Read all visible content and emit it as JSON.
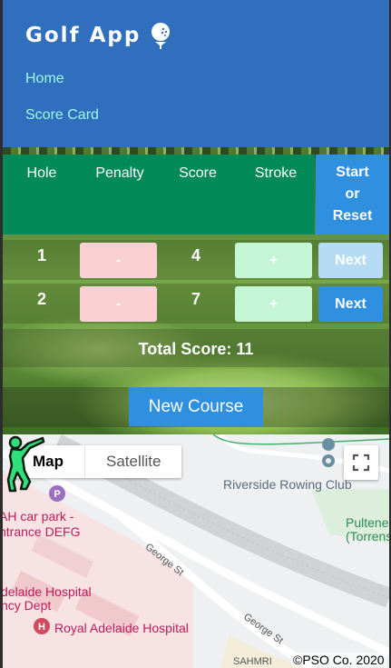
{
  "header": {
    "brand": "Golf App",
    "nav": [
      {
        "label": "Home"
      },
      {
        "label": "Score Card"
      }
    ],
    "logo_icon": "golf-ball-tee-icon",
    "background": "#2f6fbd",
    "link_color": "#9ff7f0"
  },
  "scorecard": {
    "columns": [
      "Hole",
      "Penalty",
      "Score",
      "Stroke"
    ],
    "start_reset_label": [
      "Start",
      "or",
      "Reset"
    ],
    "rows": [
      {
        "hole": "1",
        "minus": "-",
        "score": "4",
        "plus": "+",
        "next": "Next"
      },
      {
        "hole": "2",
        "minus": "-",
        "score": "7",
        "plus": "+",
        "next": "Next"
      }
    ],
    "total_label": "Total Score: 11",
    "new_course_label": "New Course",
    "header_color": "#038a5a",
    "button_color": "#2f8fe0"
  },
  "map": {
    "type_buttons": [
      "Map",
      "Satellite"
    ],
    "labels": {
      "rowing": "Riverside Rowing Club",
      "carpark": [
        "AH car park -",
        "ntrance DEFG"
      ],
      "hospital": [
        "delaide Hospital",
        "ncy Dept"
      ],
      "rah": "Royal Adelaide Hospital",
      "pulteney": [
        "Pultene",
        "(Torrens"
      ],
      "george1": "George St",
      "george2": "George St",
      "sahmri": "SAHMRI"
    },
    "copyright": "©PSO Co. 2020",
    "marker_icon": "golfer-marker-icon",
    "fullscreen_icon": "fullscreen-icon"
  }
}
